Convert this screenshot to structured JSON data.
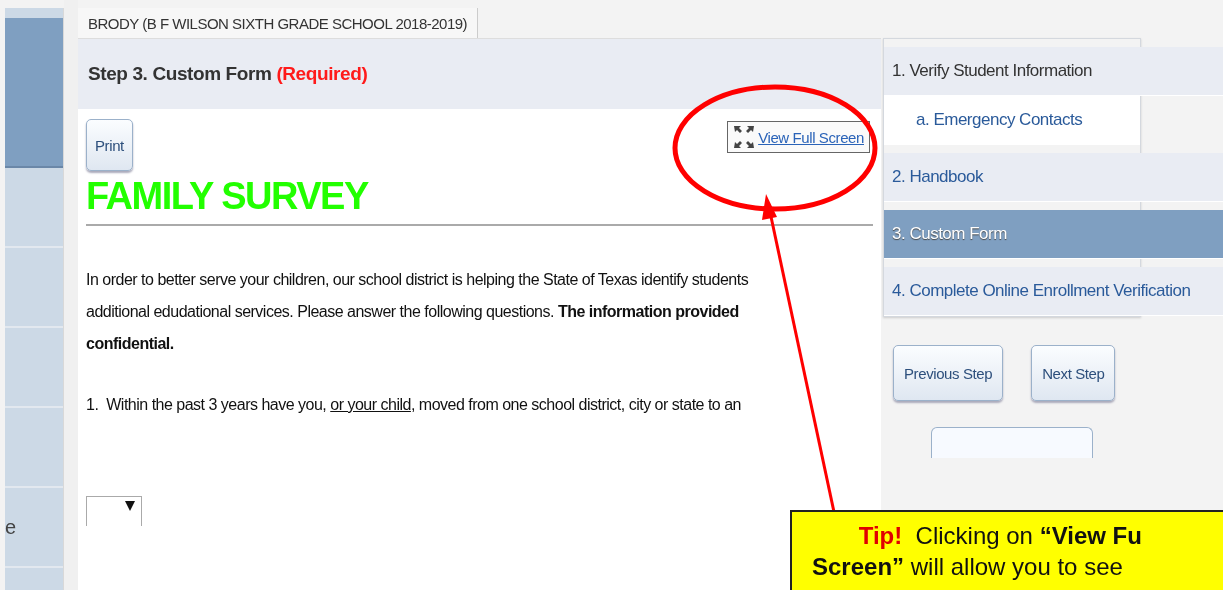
{
  "left_nav": {
    "items": [
      {
        "label": "e"
      }
    ]
  },
  "student_tab": {
    "label": "BRODY (B F WILSON SIXTH GRADE SCHOOL 2018-2019)"
  },
  "step_header": {
    "title": "Step 3. Custom Form",
    "required": "(Required)"
  },
  "print_button": "Print",
  "full_screen_link": "View Full Screen",
  "survey_title": "FAMILY SURVEY",
  "intro_lines": [
    "In order to better serve your children, our school district is helping the State of Texas identify students",
    "additional edudational services.  Please answer the following questions.  **The information provided**",
    "**confidential.**"
  ],
  "question_parts": [
    {
      "text": "1.  Within the past 3 years have you, ",
      "underline": false
    },
    {
      "text": "or your child",
      "underline": true
    },
    {
      "text": ", moved from one school district, city or state to an",
      "underline": false
    }
  ],
  "steps": [
    {
      "label": "1. Verify Student Information",
      "kind": "main",
      "selected": false
    },
    {
      "label": "a. Emergency Contacts",
      "kind": "sub",
      "selected": false
    },
    {
      "label": "2. Handbook",
      "kind": "main",
      "selected": false
    },
    {
      "label": "3. Custom Form",
      "kind": "main",
      "selected": true
    },
    {
      "label": "4. Complete Online Enrollment Verification",
      "kind": "main",
      "selected": false
    }
  ],
  "nav_buttons": [
    "Previous Step",
    "Next Step"
  ],
  "tip": {
    "label": "Tip!",
    "lines": [
      "Clicking on **“View Fu**",
      "**Screen”**  will allow you to see"
    ]
  }
}
